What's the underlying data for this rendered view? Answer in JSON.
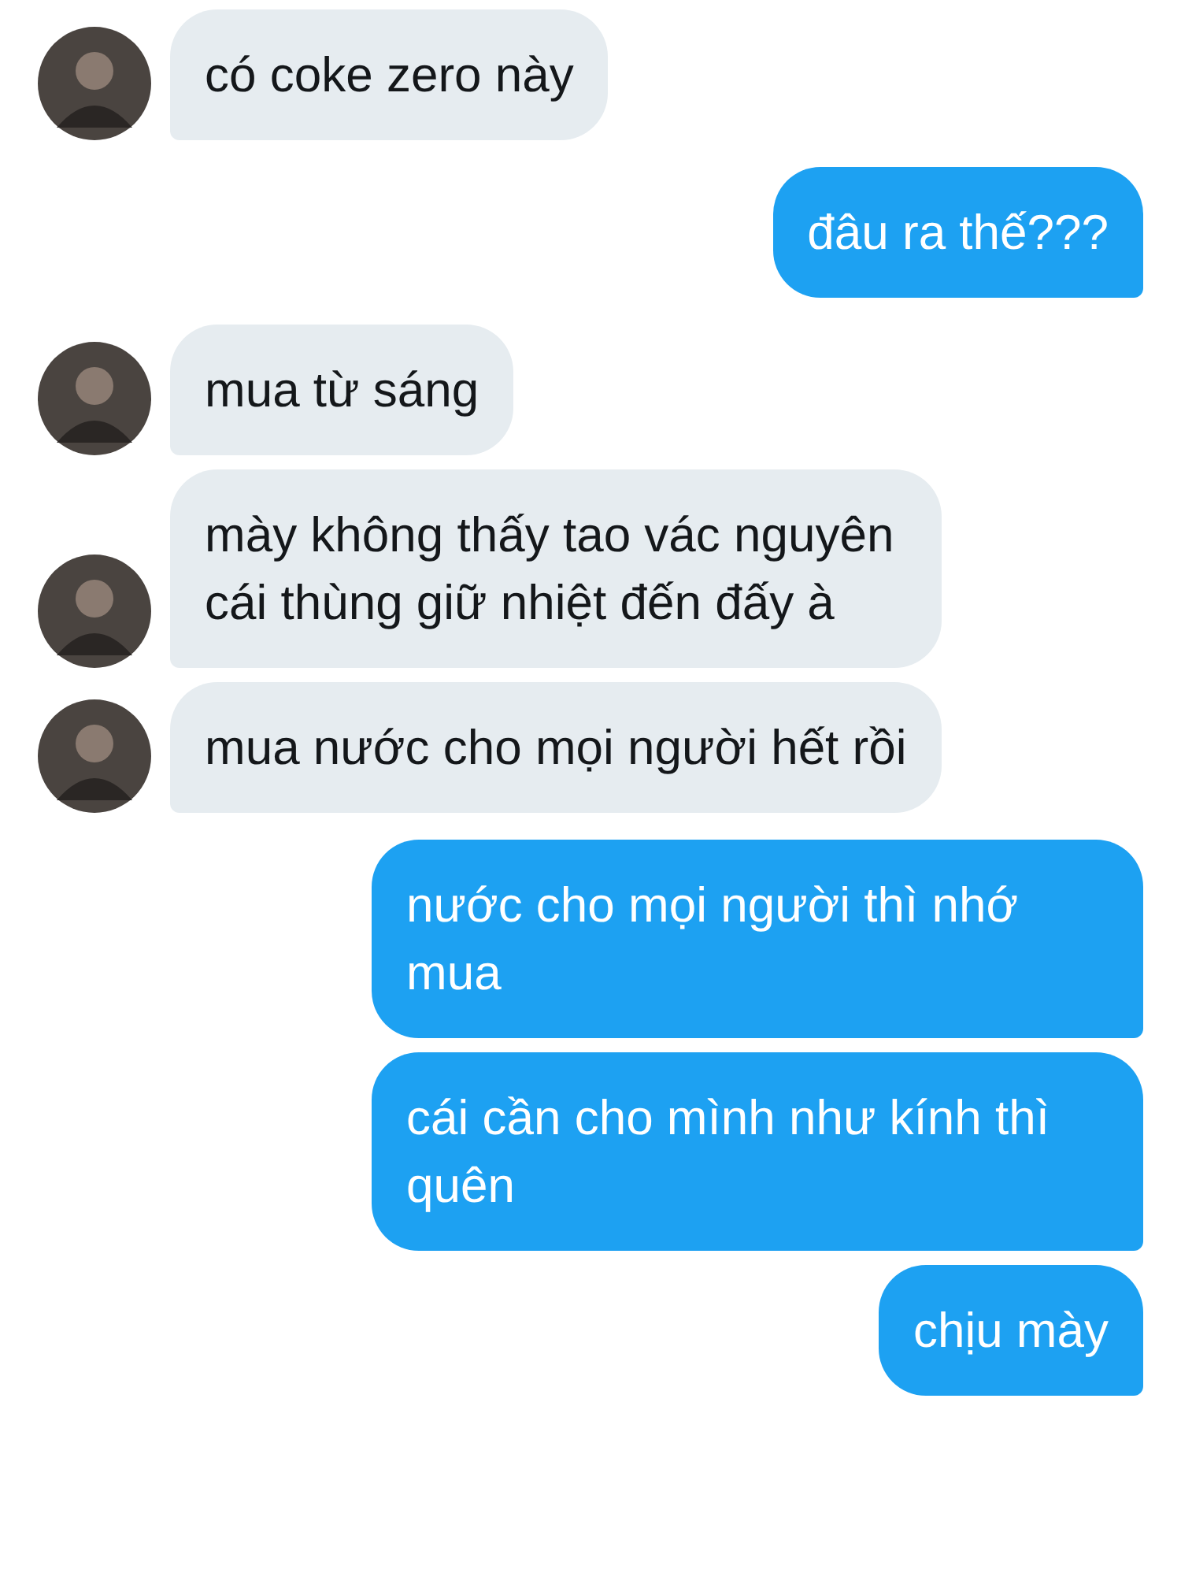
{
  "messages": [
    {
      "kind": "received",
      "text": "có coke zero này"
    },
    {
      "kind": "sent",
      "text": "đâu ra thế???"
    },
    {
      "kind": "received",
      "text": "mua từ sáng"
    },
    {
      "kind": "received",
      "text": "mày không thấy tao vác nguyên cái thùng giữ nhiệt đến đấy à"
    },
    {
      "kind": "received",
      "text": "mua nước cho mọi người hết rồi"
    },
    {
      "kind": "sent",
      "text": "nước cho mọi người thì nhớ mua"
    },
    {
      "kind": "sent",
      "text": "cái cần cho mình như kính thì quên"
    },
    {
      "kind": "sent",
      "text": "chịu mày"
    }
  ]
}
